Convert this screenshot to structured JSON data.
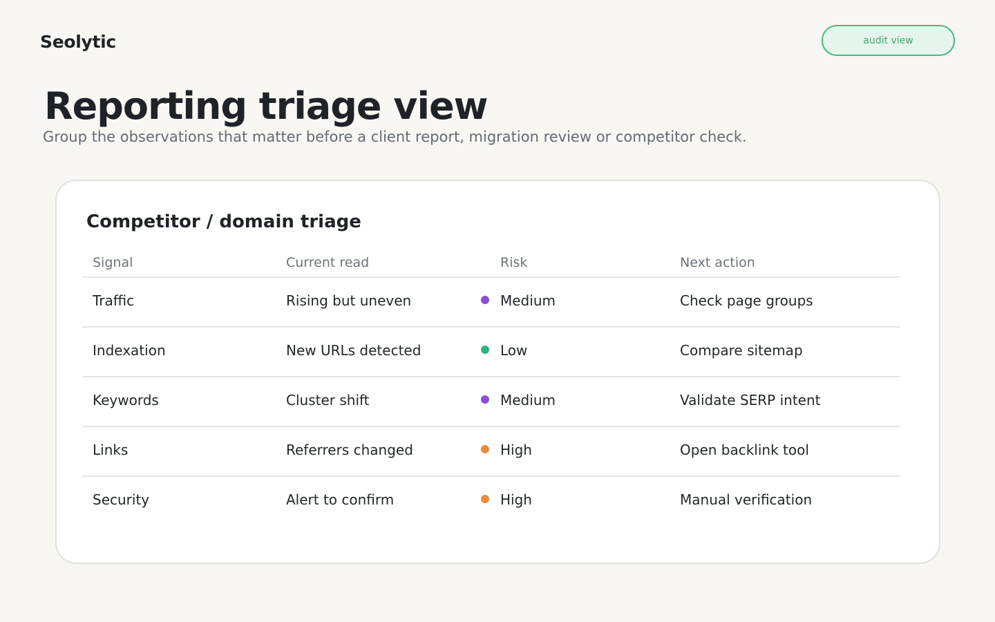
{
  "brand": "Seolytic",
  "header": {
    "audit_button": "audit view"
  },
  "page": {
    "title": "Reporting triage view",
    "subtitle": "Group the observations that matter before a client report, migration review or competitor check."
  },
  "card": {
    "title": "Competitor / domain triage",
    "columns": [
      "Signal",
      "Current read",
      "Risk",
      "Next action"
    ],
    "rows": [
      {
        "signal": "Traffic",
        "read": "Rising but uneven",
        "risk": "Medium",
        "risk_color": "#8b4fd6",
        "action": "Check page groups"
      },
      {
        "signal": "Indexation",
        "read": "New URLs detected",
        "risk": "Low",
        "risk_color": "#2eb67d",
        "action": "Compare sitemap"
      },
      {
        "signal": "Keywords",
        "read": "Cluster shift",
        "risk": "Medium",
        "risk_color": "#8b4fd6",
        "action": "Validate SERP intent"
      },
      {
        "signal": "Links",
        "read": "Referrers changed",
        "risk": "High",
        "risk_color": "#ea8c3a",
        "action": "Open backlink tool"
      },
      {
        "signal": "Security",
        "read": "Alert to confirm",
        "risk": "High",
        "risk_color": "#ea8c3a",
        "action": "Manual verification"
      }
    ]
  },
  "colors": {
    "accent": "#46b97d",
    "background": "#f8f7f4",
    "medium": "#8b4fd6",
    "low": "#2eb67d",
    "high": "#ea8c3a"
  }
}
